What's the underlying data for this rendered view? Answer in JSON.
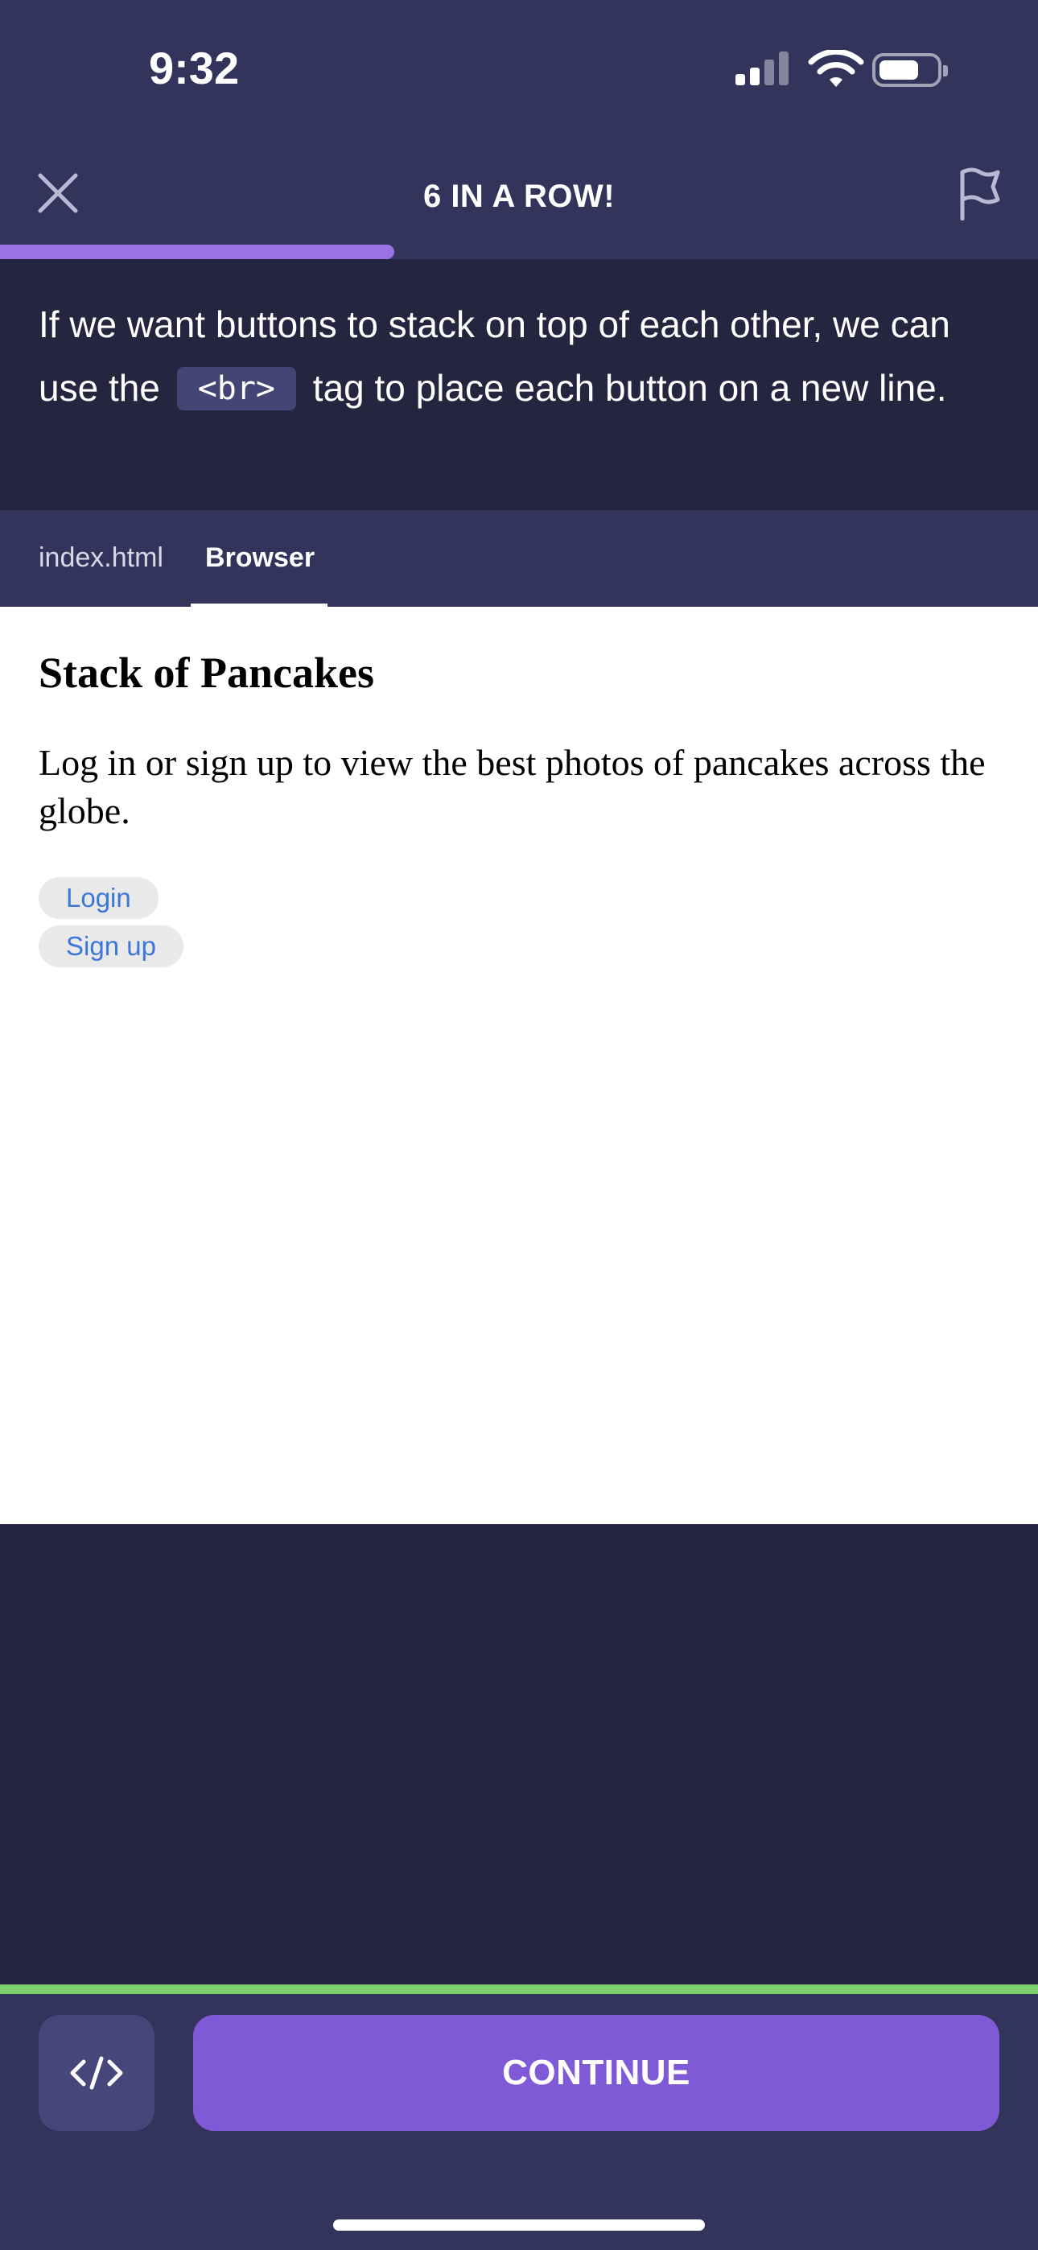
{
  "status_bar": {
    "time": "9:32",
    "icons": [
      "signal-icon",
      "wifi-icon",
      "battery-icon"
    ]
  },
  "header": {
    "title": "6 IN A ROW!",
    "close_icon": "close-icon",
    "flag_icon": "flag-icon",
    "progress_fraction": 0.38,
    "progress_color": "#9a72e6"
  },
  "instruction": {
    "before": "If we want buttons to stack on top of each other, we can use the",
    "code": "<br>",
    "after": "tag to place each button on a new line."
  },
  "tabs": [
    {
      "label": "index.html",
      "active": false
    },
    {
      "label": "Browser",
      "active": true
    }
  ],
  "browser": {
    "heading": "Stack of Pancakes",
    "paragraph": "Log in or sign up to view the best photos of pancakes across the globe.",
    "buttons": [
      "Login",
      "Sign up"
    ]
  },
  "footer": {
    "code_toggle_icon": "code-icon",
    "continue_label": "CONTINUE"
  },
  "colors": {
    "header_bg": "#33345c",
    "panel_bg": "#25253f",
    "accent_purple": "#7f5ad6",
    "success_green": "#7ecf6e",
    "link_blue": "#3b77d8"
  }
}
